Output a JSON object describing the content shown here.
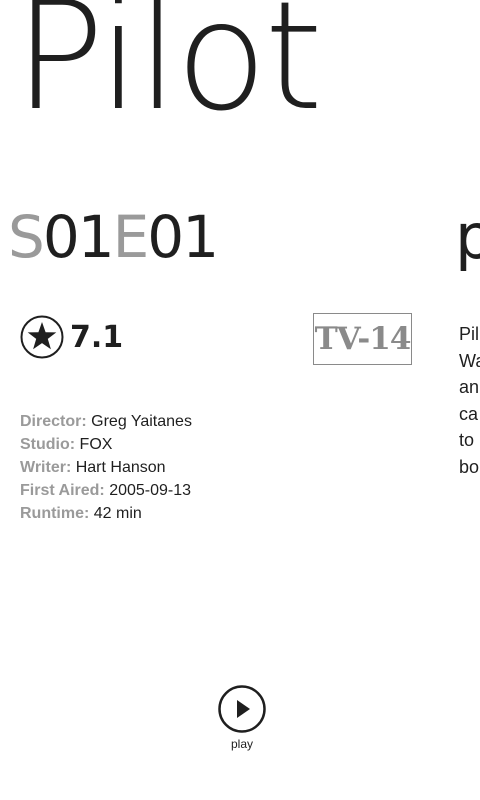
{
  "episode": {
    "title": "Pilot",
    "season_prefix": "S",
    "season_number": "01",
    "episode_prefix": "E",
    "episode_number": "01",
    "rating": "7.1",
    "certification": "TV-14"
  },
  "details": [
    {
      "label": "Director:",
      "value": "Greg Yaitanes"
    },
    {
      "label": "Studio:",
      "value": "FOX"
    },
    {
      "label": "Writer:",
      "value": "Hart Hanson"
    },
    {
      "label": "First Aired:",
      "value": "2005-09-13"
    },
    {
      "label": "Runtime:",
      "value": "42 min"
    }
  ],
  "next_panel": {
    "heading_peek": "p",
    "text_peek": [
      "Pil",
      "Wa",
      "an",
      "ca",
      "to",
      "bo"
    ]
  },
  "app_bar": {
    "play_label": "play",
    "play_icon": "play-icon"
  },
  "colors": {
    "foreground": "#1f1f1f",
    "subtle": "#9a9a9a",
    "background": "#ffffff"
  }
}
